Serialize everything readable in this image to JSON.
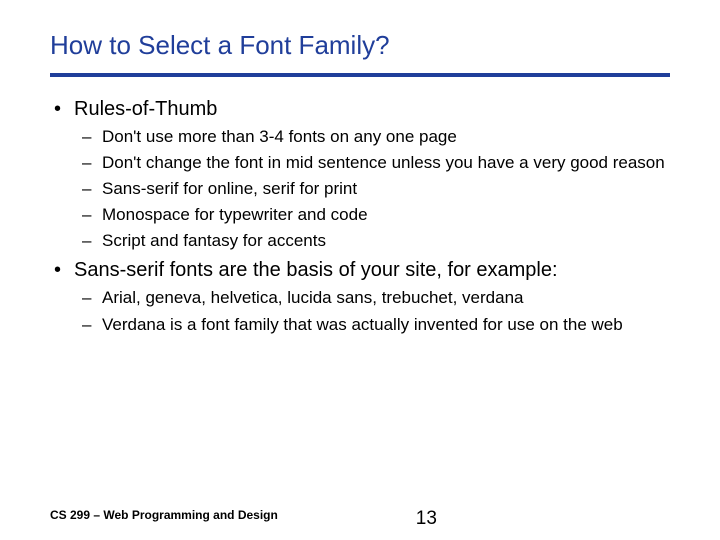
{
  "title": "How to Select a Font Family?",
  "b1": "Rules-of-Thumb",
  "b1s1": "Don't use more than 3-4 fonts on any one page",
  "b1s2": "Don't change the font in mid sentence unless you have a very good reason",
  "b1s3": "Sans-serif for online, serif for print",
  "b1s4": "Monospace for typewriter and code",
  "b1s5": "Script and fantasy for accents",
  "b2": "Sans-serif fonts are the basis of your site, for example:",
  "b2s1": "Arial, geneva, helvetica, lucida sans, trebuchet, verdana",
  "b2s2": "Verdana is a font family that was actually invented for use on the web",
  "footer_course": "CS 299 – Web Programming and Design",
  "footer_page": "13"
}
